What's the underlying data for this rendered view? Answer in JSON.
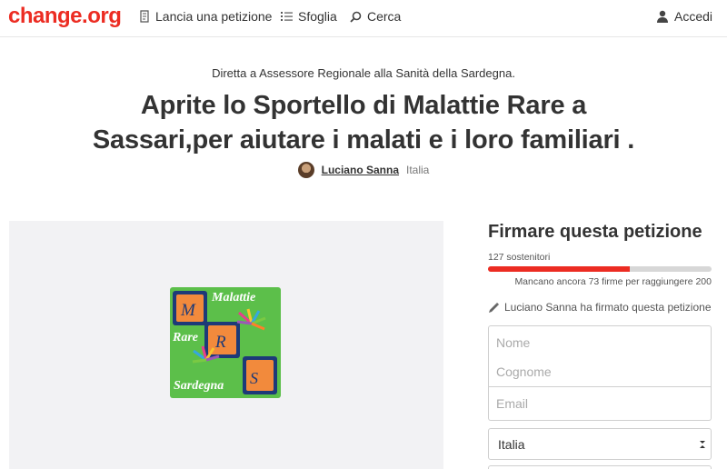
{
  "header": {
    "logo": "change.org",
    "nav": {
      "start_petition": "Lancia una petizione",
      "browse": "Sfoglia",
      "search": "Cerca",
      "login": "Accedi"
    }
  },
  "petition": {
    "target": "Diretta a Assessore Regionale alla Sanità della Sardegna.",
    "title_line1": "Aprite lo Sportello di Malattie Rare a",
    "title_line2": "Sassari,per aiutare i malati e i loro familiari .",
    "author_name": "Luciano Sanna",
    "author_country": "Italia",
    "logo_text": {
      "malattie": "Malattie",
      "rare": "Rare",
      "sardegna": "Sardegna",
      "m": "M",
      "r": "R",
      "s": "S"
    }
  },
  "sign": {
    "title": "Firmare questa petizione",
    "supporters": "127 sostenitori",
    "progress_fraction": 0.635,
    "remaining": "Mancano ancora 73 firme per raggiungere 200",
    "signed_note": "Luciano Sanna ha firmato questa petizione",
    "placeholders": {
      "first_name": "Nome",
      "last_name": "Cognome",
      "email": "Email"
    },
    "country_selected": "Italia"
  },
  "colors": {
    "brand": "#ec2c22",
    "logo_green": "#5cbf4a",
    "logo_blue": "#1d3a78",
    "logo_orange": "#f28a3c"
  }
}
